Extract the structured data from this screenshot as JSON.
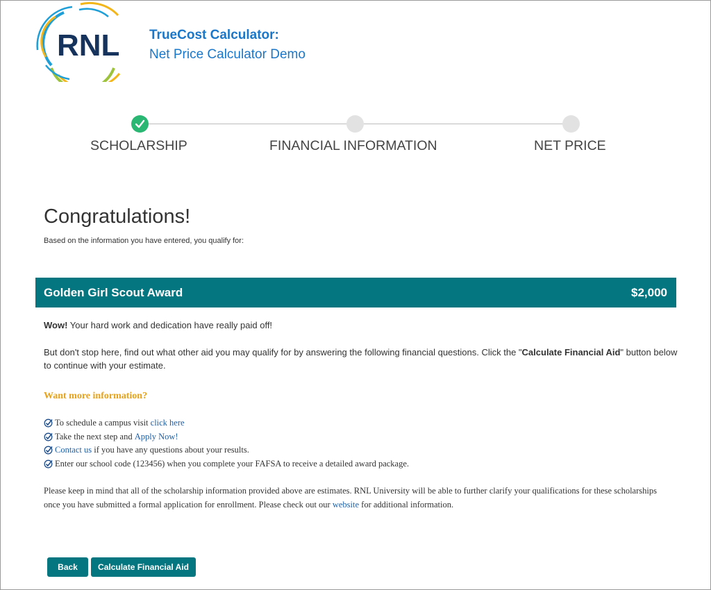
{
  "header": {
    "logo_text": "RNL",
    "title": "TrueCost Calculator:",
    "subtitle": "Net Price Calculator Demo"
  },
  "stepper": {
    "steps": [
      {
        "label": "SCHOLARSHIP",
        "status": "complete"
      },
      {
        "label": "FINANCIAL INFORMATION",
        "status": "incomplete"
      },
      {
        "label": "NET PRICE",
        "status": "incomplete"
      }
    ]
  },
  "main": {
    "heading": "Congratulations!",
    "intro": "Based on the information you have entered, you qualify for:",
    "award": {
      "name": "Golden Girl Scout Award",
      "amount": "$2,000"
    },
    "wow_bold": "Wow!",
    "wow_text": " Your hard work and dedication have really paid off!",
    "p2_before": "But don't stop here, find out what other aid you may qualify for by answering the following financial questions. Click the \"",
    "p2_bold": "Calculate Financial Aid",
    "p2_after": "\" button below to continue with your estimate.",
    "more_heading": "Want more information?",
    "list": {
      "item1_text": "To schedule a campus visit ",
      "item1_link": "click here",
      "item2_text": "Take the next step and ",
      "item2_link": "Apply Now!",
      "item3_link": "Contact us",
      "item3_text": " if you have any questions about your results.",
      "item4_text": "Enter our school code (123456) when you complete your FAFSA to receive a detailed award package."
    },
    "disclaimer_before": "Please keep in mind that all of the scholarship information provided above are estimates. RNL University will be able to further clarify your qualifications for these scholarships once you have submitted a formal application for enrollment. Please check out our ",
    "disclaimer_link": "website",
    "disclaimer_after": " for additional information."
  },
  "buttons": {
    "back": "Back",
    "calculate": "Calculate Financial Aid"
  },
  "colors": {
    "accent": "#047680",
    "brand_blue": "#1a77c9",
    "complete_green": "#2ab673",
    "gold": "#e8a21a",
    "link": "#1f5fa8"
  },
  "icons": {
    "step_complete": "check-icon",
    "list_bullet": "checkmark-circle-icon"
  }
}
